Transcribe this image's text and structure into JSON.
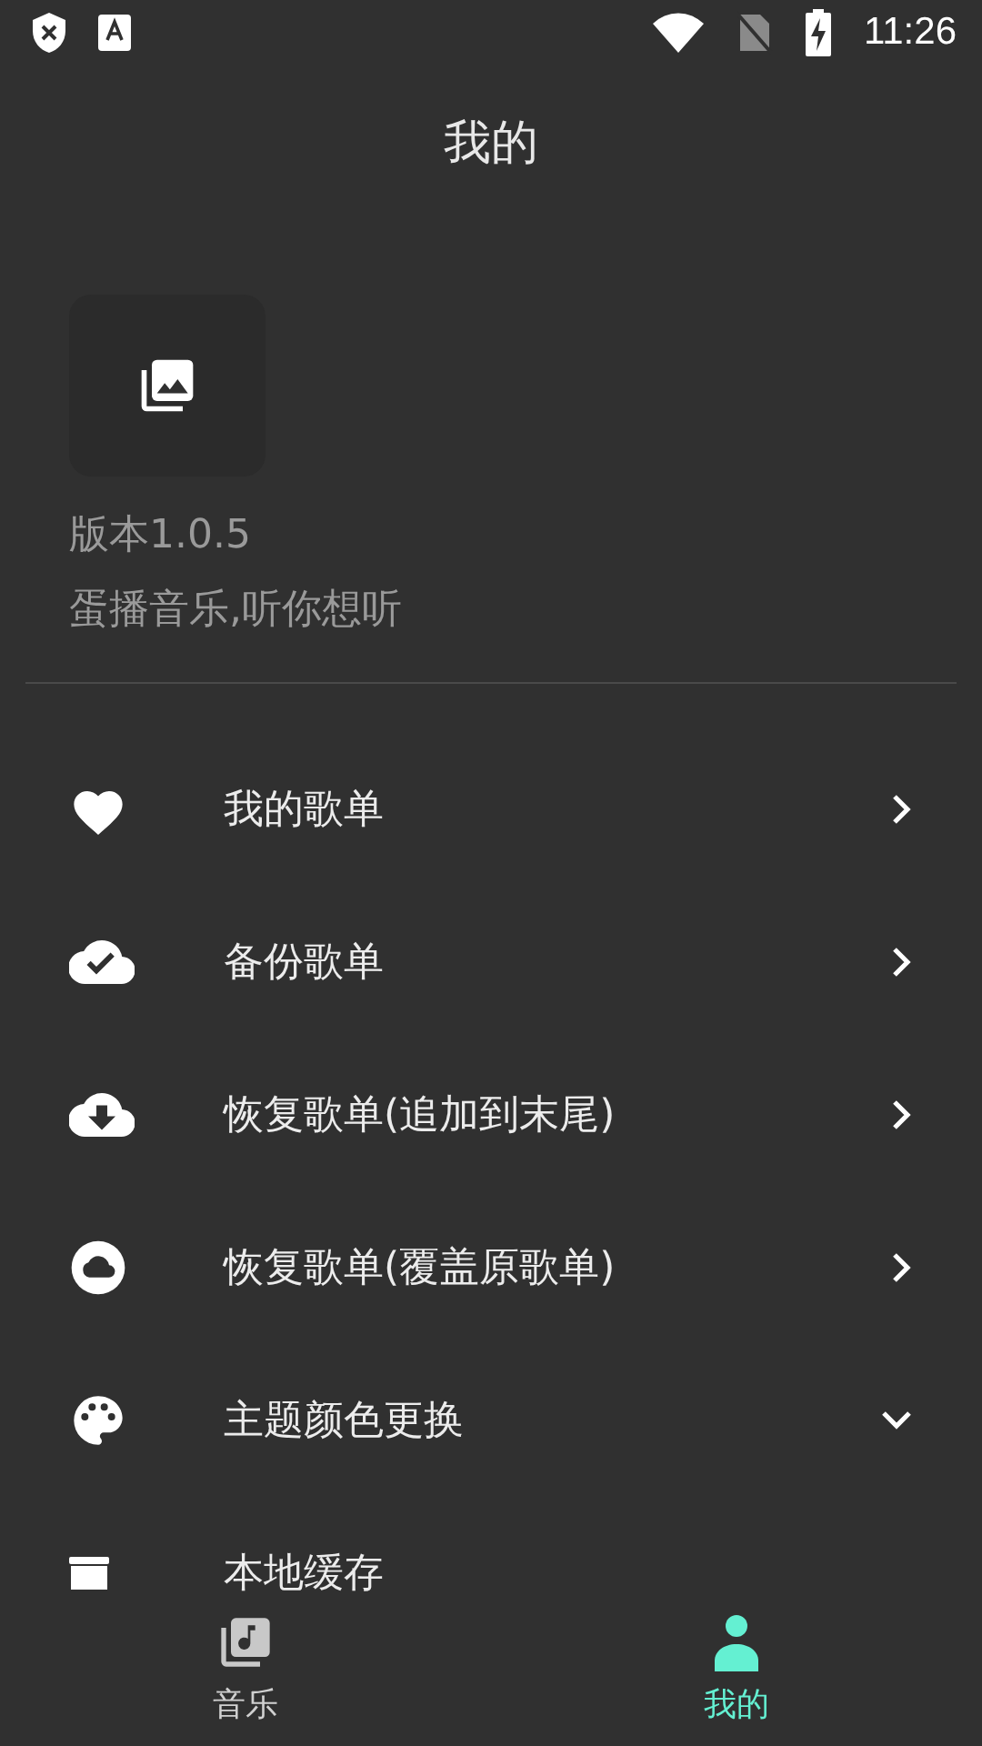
{
  "status_bar": {
    "time": "11:26"
  },
  "header": {
    "title": "我的"
  },
  "app_info": {
    "version": "版本1.0.5",
    "tagline": "蛋播音乐,听你想听"
  },
  "menu": [
    {
      "label": "我的歌单",
      "kind": "link"
    },
    {
      "label": "备份歌单",
      "kind": "link"
    },
    {
      "label": "恢复歌单(追加到末尾)",
      "kind": "link"
    },
    {
      "label": "恢复歌单(覆盖原歌单)",
      "kind": "link"
    },
    {
      "label": "主题颜色更换",
      "kind": "expand",
      "expanded": false
    },
    {
      "label": "本地缓存",
      "kind": "plain"
    }
  ],
  "bottom_nav": [
    {
      "label": "音乐",
      "selected": false
    },
    {
      "label": "我的",
      "selected": true
    }
  ]
}
